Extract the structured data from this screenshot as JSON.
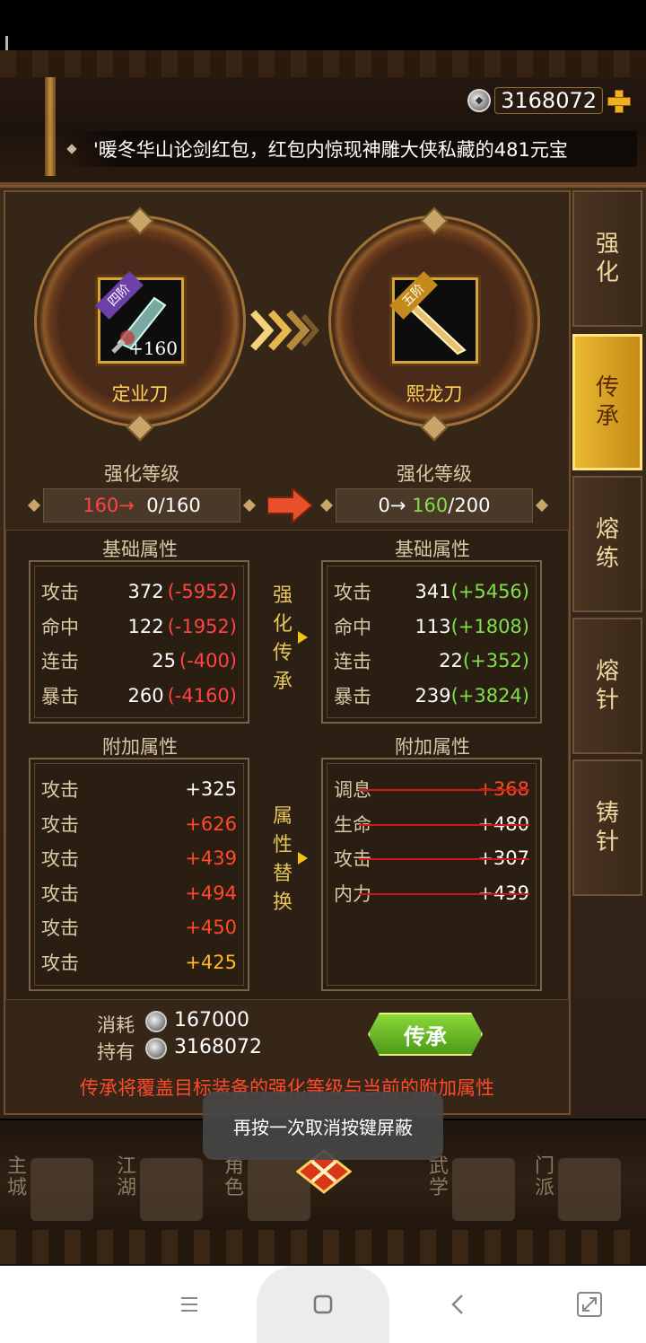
{
  "currency": {
    "value": "3168072"
  },
  "marquee": {
    "text": "'暖冬华山论剑红包，红包内惊现神雕大侠私藏的481元宝"
  },
  "source_equip": {
    "tier": "四阶",
    "enhance": "+160",
    "name": "定业刀"
  },
  "target_equip": {
    "tier": "五阶",
    "name": "熙龙刀"
  },
  "source_level": {
    "title": "强化等级",
    "from": "160→",
    "value": "0/160"
  },
  "target_level": {
    "title": "强化等级",
    "from": "0→",
    "mid": "160",
    "max": "/200"
  },
  "base_title_left": "基础属性",
  "base_title_right": "基础属性",
  "base_left": [
    {
      "label": "攻击",
      "value": "372",
      "delta": "(-5952)"
    },
    {
      "label": "命中",
      "value": "122",
      "delta": "(-1952)"
    },
    {
      "label": "连击",
      "value": "25",
      "delta": "(-400)"
    },
    {
      "label": "暴击",
      "value": "260",
      "delta": "(-4160)"
    }
  ],
  "base_right": [
    {
      "label": "攻击",
      "value": "341",
      "delta": "(+5456)"
    },
    {
      "label": "命中",
      "value": "113",
      "delta": "(+1808)"
    },
    {
      "label": "连击",
      "value": "22",
      "delta": "(+352)"
    },
    {
      "label": "暴击",
      "value": "239",
      "delta": "(+3824)"
    }
  ],
  "mid_label_1": [
    "强",
    "化",
    "传",
    "承"
  ],
  "mid_label_2": [
    "属",
    "性",
    "替",
    "换"
  ],
  "extra_title_left": "附加属性",
  "extra_title_right": "附加属性",
  "extra_left": [
    {
      "label": "攻击",
      "value": "+325",
      "color": "#ffffff"
    },
    {
      "label": "攻击",
      "value": "+626",
      "color": "#ff4a2a"
    },
    {
      "label": "攻击",
      "value": "+439",
      "color": "#ff4a2a"
    },
    {
      "label": "攻击",
      "value": "+494",
      "color": "#ff4a2a"
    },
    {
      "label": "攻击",
      "value": "+450",
      "color": "#ff4a2a"
    },
    {
      "label": "攻击",
      "value": "+425",
      "color": "#ffb820"
    }
  ],
  "extra_right": [
    {
      "label": "调息",
      "value": "+368",
      "color": "#ff4a2a"
    },
    {
      "label": "生命",
      "value": "+480",
      "color": "#ffffff"
    },
    {
      "label": "攻击",
      "value": "+307",
      "color": "#ffffff"
    },
    {
      "label": "内力",
      "value": "+439",
      "color": "#ffffff"
    }
  ],
  "cost": {
    "consume_label": "消耗",
    "consume_value": "167000",
    "hold_label": "持有",
    "hold_value": "3168072"
  },
  "inherit_button": "传承",
  "warning": "传承将覆盖目标装备的强化等级与当前的附加属性",
  "side_tabs": [
    {
      "label": [
        "强",
        "化"
      ],
      "active": false
    },
    {
      "label": [
        "传",
        "承"
      ],
      "active": true
    },
    {
      "label": [
        "熔",
        "练"
      ],
      "active": false
    },
    {
      "label": [
        "熔",
        "针"
      ],
      "active": false
    },
    {
      "label": [
        "铸",
        "针"
      ],
      "active": false
    }
  ],
  "bottom_nav": [
    {
      "label": [
        "主",
        "城"
      ]
    },
    {
      "label": [
        "江",
        "湖"
      ]
    },
    {
      "label": [
        "角",
        "色"
      ]
    },
    {
      "label": [
        "武",
        "学"
      ]
    },
    {
      "label": [
        "门",
        "派"
      ]
    }
  ],
  "toast": "再按一次取消按键屏蔽"
}
